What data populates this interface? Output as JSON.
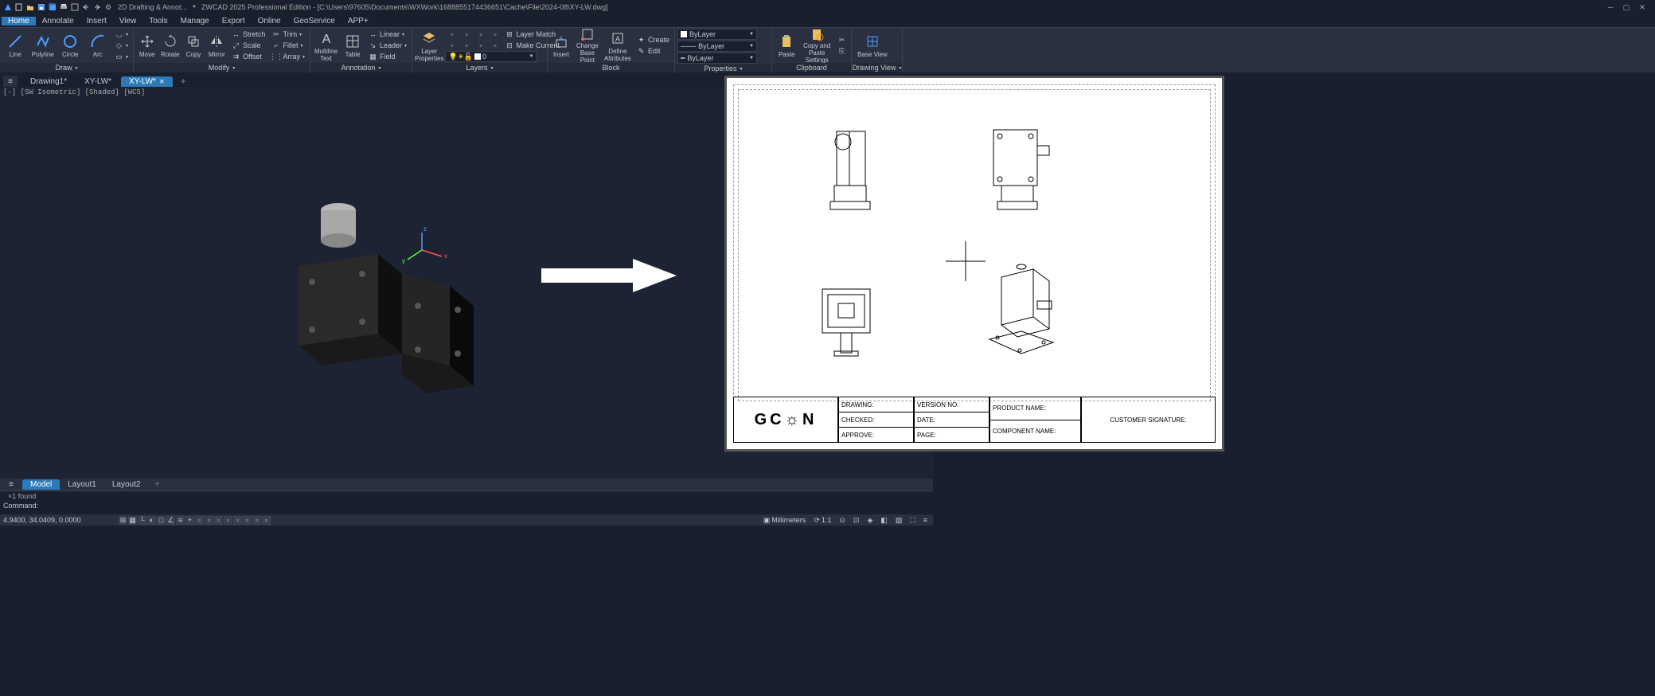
{
  "title": "ZWCAD 2025 Professional Edition - [C:\\Users\\97605\\Documents\\WXWork\\1688855174436651\\Cache\\File\\2024-08\\XY-LW.dwg]",
  "qat_workspace": "2D Drafting & Annot...",
  "menus": [
    "Home",
    "Annotate",
    "Insert",
    "View",
    "Tools",
    "Manage",
    "Export",
    "Online",
    "GeoService",
    "APP+"
  ],
  "drawpanel": {
    "label": "Draw",
    "items": [
      "Line",
      "Polyline",
      "Circle",
      "Arc"
    ]
  },
  "modifypanel": {
    "label": "Modify",
    "items": [
      "Move",
      "Rotate",
      "Copy",
      "Mirror"
    ],
    "small": [
      "Stretch",
      "Trim",
      "Scale",
      "Fillet",
      "Offset",
      "Array"
    ]
  },
  "annot": {
    "label": "Annotation",
    "items": [
      "Multiline Text",
      "Table"
    ],
    "small": [
      "Linear",
      "Leader",
      "Field"
    ]
  },
  "layers": {
    "label": "Layers",
    "prop": "Layer Properties",
    "small": [
      "Layer Match",
      "Make Current"
    ],
    "current": "0"
  },
  "block": {
    "label": "Block",
    "items": [
      "Insert",
      "Change Base Point",
      "Define Attributes"
    ],
    "small": [
      "Create",
      "Edit"
    ]
  },
  "props": {
    "label": "Properties",
    "layer": "ByLayer",
    "line": "ByLayer",
    "weight": "ByLayer"
  },
  "clip": {
    "label": "Clipboard",
    "items": [
      "Paste",
      "Copy and Paste Settings"
    ]
  },
  "dview": {
    "label": "Drawing View",
    "items": [
      "Base View"
    ]
  },
  "doctabs": [
    "Drawing1*",
    "XY-LW*",
    "XY-LW*"
  ],
  "activeDoctab": 2,
  "vp_label": "[-] [SW Isometric] [Shaded] [WCS]",
  "mtabs": [
    "Model",
    "Layout1",
    "Layout2"
  ],
  "activeMtab": 0,
  "cmd_hist": "1 found",
  "cmd_prompt": "Command:",
  "coords": "4.9400, 34.0409, 0.0000",
  "status_unit": "Millimeters",
  "status_scale": "1:1",
  "tblock": {
    "logo": "GC☼N",
    "drawing": "DRAWING:",
    "checked": "CHECKED:",
    "approve": "APPROVE:",
    "version": "VERSION NO.",
    "date": "DATE:",
    "page": "PAGE:",
    "product": "PRODUCT NAME:",
    "component": "COMPONENT NAME:",
    "customer": "CUSTOMER SIGNATURE:"
  }
}
